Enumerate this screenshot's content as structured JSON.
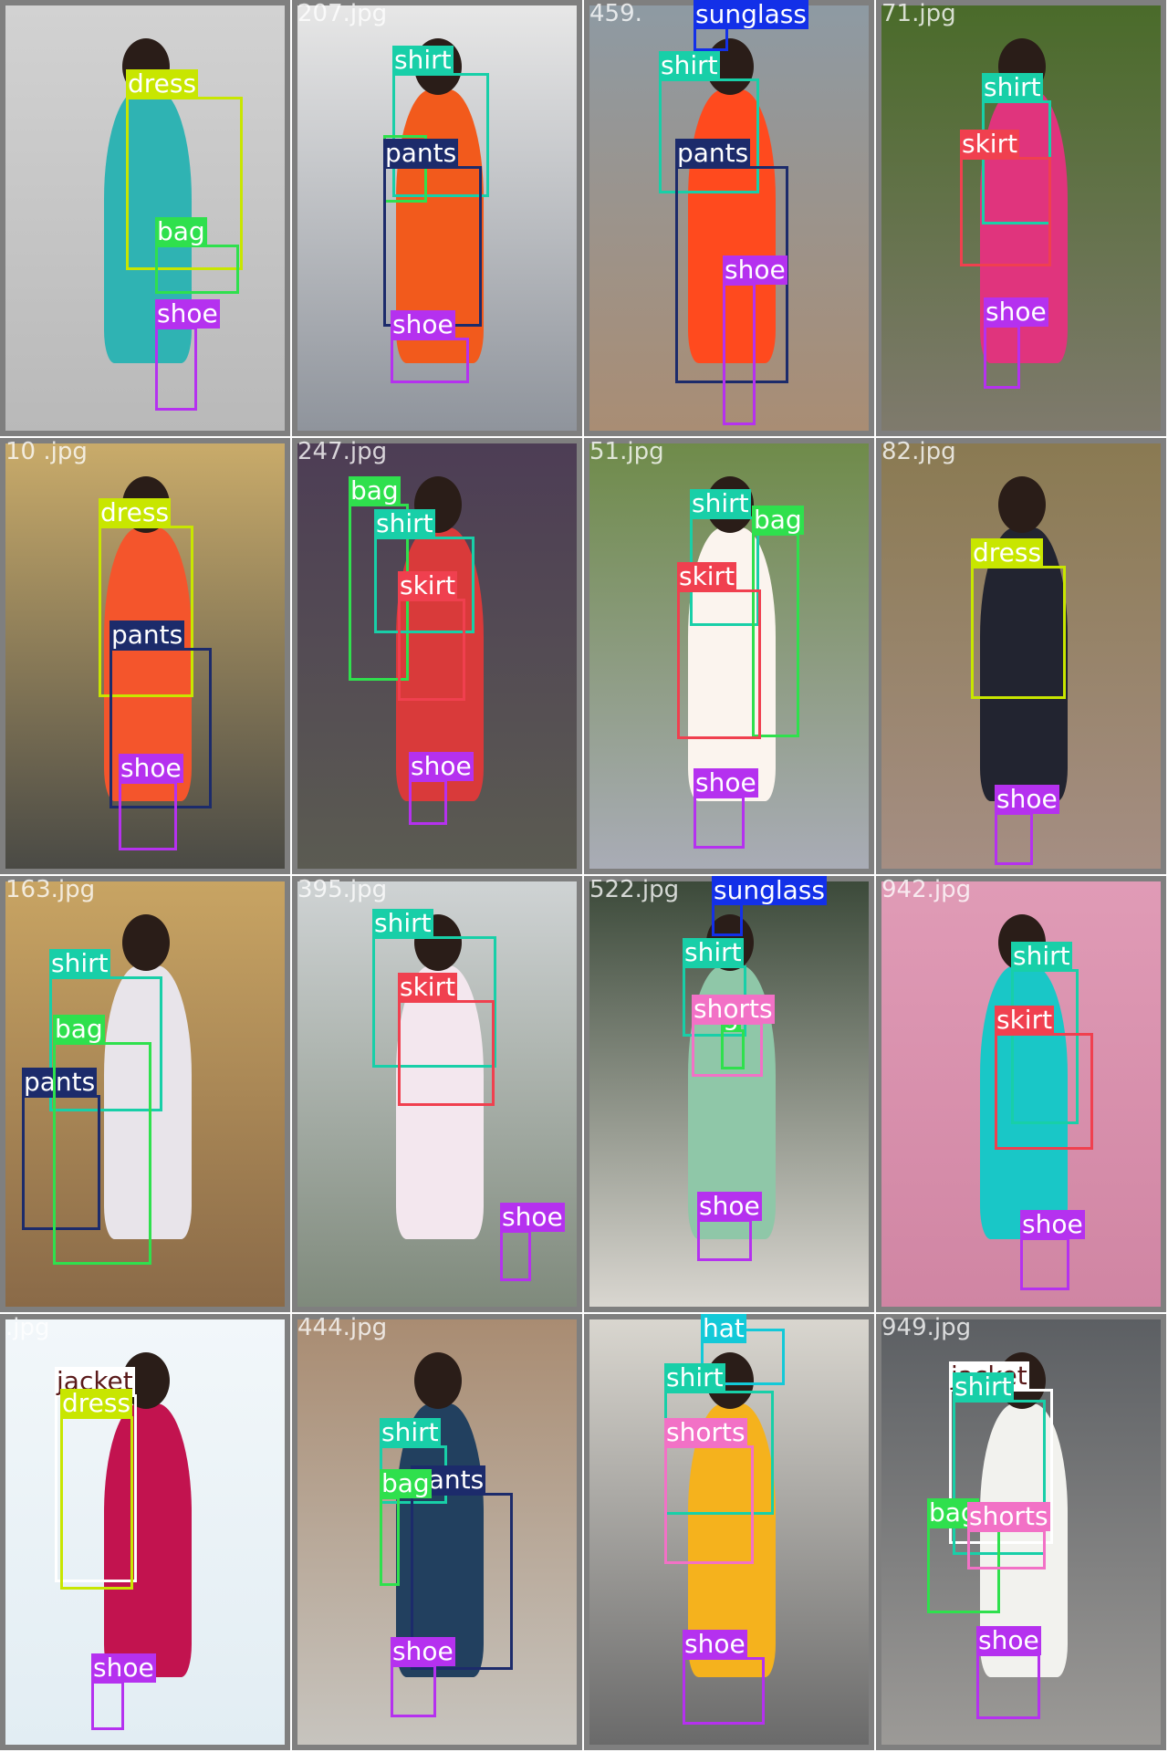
{
  "class_colors": {
    "dress": "#c8e600",
    "shirt": "#18cfa8",
    "pants": "#1c2b6b",
    "bag": "#2fe04d",
    "shoe": "#b531ef",
    "skirt": "#f0404f",
    "sunglass": "#1330e8",
    "shorts": "#f271c6",
    "hat": "#13c9d8",
    "jacket": "#ffffff"
  },
  "tiles": [
    {
      "file": "",
      "bg": [
        "#d2d2d2",
        "#b9b9b9"
      ],
      "person": "#2fb3b3",
      "boxes": [
        {
          "cls": "dress",
          "label": "dress"
        },
        {
          "cls": "bag",
          "label": "bag"
        },
        {
          "cls": "shoe",
          "label": "shoe"
        }
      ]
    },
    {
      "file": "207.jpg",
      "bg": [
        "#e7e7e7",
        "#8f949c"
      ],
      "person": "#f25a1c",
      "boxes": [
        {
          "cls": "shirt",
          "label": "shirt"
        },
        {
          "cls": "bag",
          "label": ""
        },
        {
          "cls": "pants",
          "label": "pants"
        },
        {
          "cls": "shoe",
          "label": "shoe"
        }
      ]
    },
    {
      "file": "459.",
      "bg": [
        "#8e9aa3",
        "#a98d74"
      ],
      "person": "#ff4a1e",
      "boxes": [
        {
          "cls": "sunglass",
          "label": "sunglass"
        },
        {
          "cls": "shirt",
          "label": "shirt"
        },
        {
          "cls": "pants",
          "label": "pants"
        },
        {
          "cls": "shoe",
          "label": "shoe"
        }
      ]
    },
    {
      "file": "71.jpg",
      "bg": [
        "#4a6b2a",
        "#7f7a6d"
      ],
      "person": "#e0347d",
      "boxes": [
        {
          "cls": "shirt",
          "label": "shirt"
        },
        {
          "cls": "skirt",
          "label": "skirt"
        },
        {
          "cls": "shoe",
          "label": "shoe"
        }
      ]
    },
    {
      "file": "10 .jpg",
      "bg": [
        "#c9ab6a",
        "#4a4a45"
      ],
      "person": "#f4552c",
      "boxes": [
        {
          "cls": "dress",
          "label": "dress"
        },
        {
          "cls": "pants",
          "label": "pants"
        },
        {
          "cls": "shoe",
          "label": "shoe"
        }
      ]
    },
    {
      "file": "247.jpg",
      "bg": [
        "#4d3d55",
        "#5b5b52"
      ],
      "person": "#d93a3a",
      "boxes": [
        {
          "cls": "bag",
          "label": "bag"
        },
        {
          "cls": "shirt",
          "label": "shirt"
        },
        {
          "cls": "skirt",
          "label": "skirt"
        },
        {
          "cls": "shoe",
          "label": "shoe"
        }
      ]
    },
    {
      "file": "51.jpg",
      "bg": [
        "#6f8b4a",
        "#a9acb6"
      ],
      "person": "#fbf4ee",
      "boxes": [
        {
          "cls": "shirt",
          "label": "shirt"
        },
        {
          "cls": "bag",
          "label": "bag"
        },
        {
          "cls": "skirt",
          "label": "skirt"
        },
        {
          "cls": "shoe",
          "label": "shoe"
        }
      ]
    },
    {
      "file": "82.jpg",
      "bg": [
        "#8a7a52",
        "#a58e83"
      ],
      "person": "#222430",
      "boxes": [
        {
          "cls": "dress",
          "label": "dress"
        },
        {
          "cls": "shoe",
          "label": "shoe"
        }
      ]
    },
    {
      "file": "163.jpg",
      "bg": [
        "#c8a463",
        "#8a6a48"
      ],
      "person": "#e8e4ea",
      "boxes": [
        {
          "cls": "shirt",
          "label": "shirt"
        },
        {
          "cls": "pants",
          "label": "pants"
        },
        {
          "cls": "bag",
          "label": "bag"
        }
      ]
    },
    {
      "file": "395.jpg",
      "bg": [
        "#cfd3d4",
        "#7f8a7c"
      ],
      "person": "#f3e7ee",
      "boxes": [
        {
          "cls": "shirt",
          "label": "shirt"
        },
        {
          "cls": "skirt",
          "label": "skirt"
        },
        {
          "cls": "shoe",
          "label": "shoe"
        }
      ]
    },
    {
      "file": "522.jpg",
      "bg": [
        "#3c4a3a",
        "#d9d6d0"
      ],
      "person": "#8fc7a8",
      "boxes": [
        {
          "cls": "sunglass",
          "label": "sunglass"
        },
        {
          "cls": "shirt",
          "label": "shirt"
        },
        {
          "cls": "bag",
          "label": "g"
        },
        {
          "cls": "shorts",
          "label": "shorts"
        },
        {
          "cls": "shoe",
          "label": "shoe"
        }
      ]
    },
    {
      "file": "942.jpg",
      "bg": [
        "#e09bb6",
        "#d085a3"
      ],
      "person": "#19c7c7",
      "boxes": [
        {
          "cls": "shirt",
          "label": "shirt"
        },
        {
          "cls": "skirt",
          "label": "skirt"
        },
        {
          "cls": "shoe",
          "label": "shoe"
        }
      ]
    },
    {
      "file": "  .jpg",
      "bg": [
        "#f2f7fa",
        "#e2edf3"
      ],
      "person": "#c2134f",
      "boxes": [
        {
          "cls": "jacket",
          "label": "jacket"
        },
        {
          "cls": "dress",
          "label": "dress"
        },
        {
          "cls": "shoe",
          "label": "shoe"
        }
      ]
    },
    {
      "file": "444.jpg",
      "bg": [
        "#a98c72",
        "#c7c4be"
      ],
      "person": "#22405f",
      "boxes": [
        {
          "cls": "shirt",
          "label": "shirt"
        },
        {
          "cls": "pants",
          "label": "pants"
        },
        {
          "cls": "bag",
          "label": "bag"
        },
        {
          "cls": "shoe",
          "label": "shoe"
        }
      ]
    },
    {
      "file": "",
      "bg": [
        "#d9d6cf",
        "#6a6a6a"
      ],
      "person": "#f5b21d",
      "boxes": [
        {
          "cls": "hat",
          "label": "hat"
        },
        {
          "cls": "shirt",
          "label": "shirt"
        },
        {
          "cls": "shorts",
          "label": "shorts"
        },
        {
          "cls": "shoe",
          "label": "shoe"
        }
      ]
    },
    {
      "file": "949.jpg",
      "bg": [
        "#5c5f63",
        "#9c9a97"
      ],
      "person": "#f2f2ee",
      "boxes": [
        {
          "cls": "jacket",
          "label": "jacket"
        },
        {
          "cls": "shirt",
          "label": "shirt"
        },
        {
          "cls": "bag",
          "label": "bag"
        },
        {
          "cls": "shorts",
          "label": "shorts"
        },
        {
          "cls": "shoe",
          "label": "shoe"
        }
      ]
    }
  ]
}
